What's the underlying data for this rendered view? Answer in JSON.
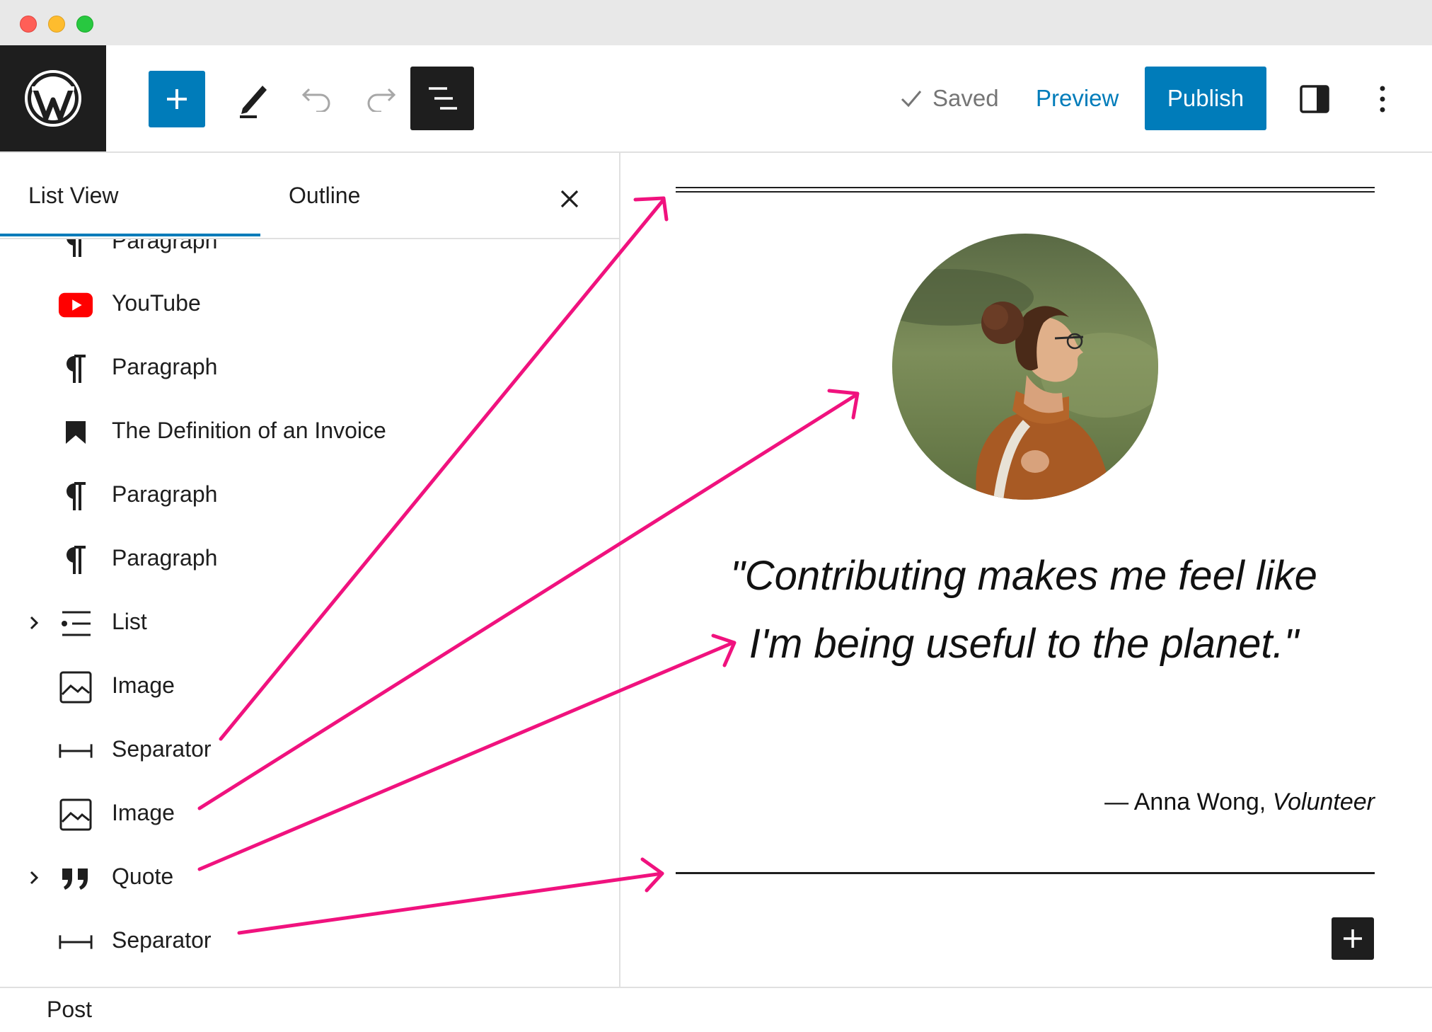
{
  "toolbar": {
    "saved_label": "Saved",
    "preview_label": "Preview",
    "publish_label": "Publish"
  },
  "sidebar": {
    "tabs": [
      {
        "label": "List View",
        "active": true
      },
      {
        "label": "Outline",
        "active": false
      }
    ],
    "items": [
      {
        "label": "Paragraph",
        "icon": "paragraph-icon"
      },
      {
        "label": "YouTube",
        "icon": "youtube-icon"
      },
      {
        "label": "Paragraph",
        "icon": "paragraph-icon"
      },
      {
        "label": "The Definition of an Invoice",
        "icon": "bookmark-icon"
      },
      {
        "label": "Paragraph",
        "icon": "paragraph-icon"
      },
      {
        "label": "Paragraph",
        "icon": "paragraph-icon"
      },
      {
        "label": "List",
        "icon": "list-icon",
        "expandable": true
      },
      {
        "label": "Image",
        "icon": "image-icon"
      },
      {
        "label": "Separator",
        "icon": "separator-icon"
      },
      {
        "label": "Image",
        "icon": "image-icon"
      },
      {
        "label": "Quote",
        "icon": "quote-icon",
        "expandable": true
      },
      {
        "label": "Separator",
        "icon": "separator-icon"
      }
    ]
  },
  "canvas": {
    "quote": "\"Contributing makes me feel like I'm being useful to the planet.\"",
    "cite_name": "— Anna Wong, ",
    "cite_role": "Volunteer"
  },
  "footer": {
    "breadcrumb": "Post"
  },
  "colors": {
    "accent": "#007cba",
    "dark": "#1e1e1e",
    "annotation_arrow": "#f0127e",
    "youtube_red": "#ff0000"
  }
}
